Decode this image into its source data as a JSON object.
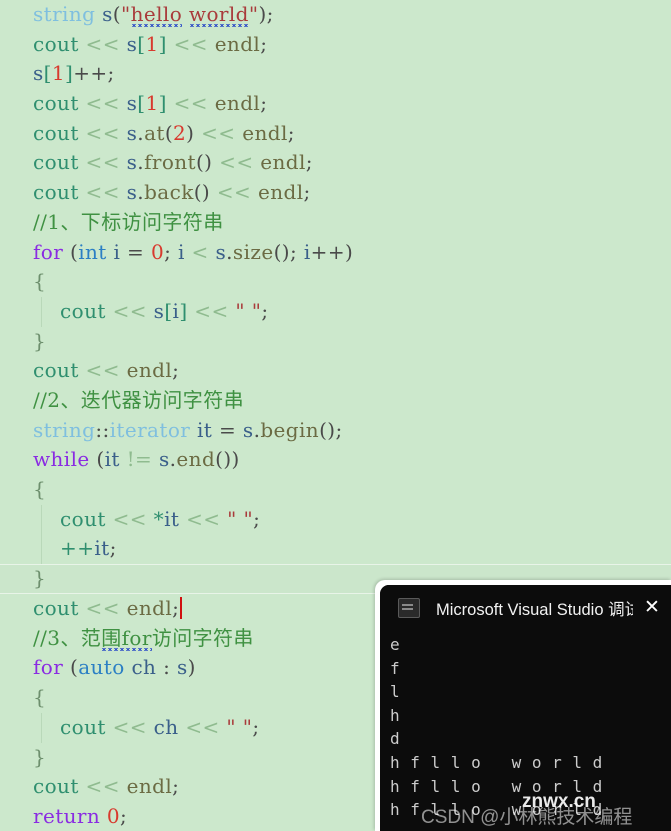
{
  "editor": {
    "background": "#cce8cc",
    "caret_color": "#d01010",
    "current_line_index": 19,
    "lines": [
      {
        "indent": 0,
        "guide": false,
        "tokens": [
          {
            "t": "string",
            "c": "t-type"
          },
          {
            "t": " ",
            "c": "t-plain"
          },
          {
            "t": "s",
            "c": "t-ident"
          },
          {
            "t": "(",
            "c": "t-punct"
          },
          {
            "t": "\"",
            "c": "t-str"
          },
          {
            "t": "hello",
            "c": "t-str",
            "squiggle": true
          },
          {
            "t": " ",
            "c": "t-str"
          },
          {
            "t": "world",
            "c": "t-str",
            "squiggle": true
          },
          {
            "t": "\"",
            "c": "t-str"
          },
          {
            "t": ")",
            "c": "t-punct"
          },
          {
            "t": ";",
            "c": "t-punct"
          }
        ]
      },
      {
        "indent": 0,
        "guide": false,
        "tokens": [
          {
            "t": "cout",
            "c": "t-stream"
          },
          {
            "t": " ",
            "c": "t-plain"
          },
          {
            "t": "<<",
            "c": "t-op"
          },
          {
            "t": " ",
            "c": "t-plain"
          },
          {
            "t": "s",
            "c": "t-ident"
          },
          {
            "t": "[",
            "c": "t-stream"
          },
          {
            "t": "1",
            "c": "t-num"
          },
          {
            "t": "]",
            "c": "t-stream"
          },
          {
            "t": " ",
            "c": "t-plain"
          },
          {
            "t": "<<",
            "c": "t-op"
          },
          {
            "t": " ",
            "c": "t-plain"
          },
          {
            "t": "endl",
            "c": "t-member"
          },
          {
            "t": ";",
            "c": "t-punct"
          }
        ]
      },
      {
        "indent": 0,
        "guide": false,
        "tokens": [
          {
            "t": "s",
            "c": "t-ident"
          },
          {
            "t": "[",
            "c": "t-stream"
          },
          {
            "t": "1",
            "c": "t-num"
          },
          {
            "t": "]",
            "c": "t-stream"
          },
          {
            "t": "++;",
            "c": "t-punct"
          }
        ]
      },
      {
        "indent": 0,
        "guide": false,
        "tokens": [
          {
            "t": "cout",
            "c": "t-stream"
          },
          {
            "t": " ",
            "c": "t-plain"
          },
          {
            "t": "<<",
            "c": "t-op"
          },
          {
            "t": " ",
            "c": "t-plain"
          },
          {
            "t": "s",
            "c": "t-ident"
          },
          {
            "t": "[",
            "c": "t-stream"
          },
          {
            "t": "1",
            "c": "t-num"
          },
          {
            "t": "]",
            "c": "t-stream"
          },
          {
            "t": " ",
            "c": "t-plain"
          },
          {
            "t": "<<",
            "c": "t-op"
          },
          {
            "t": " ",
            "c": "t-plain"
          },
          {
            "t": "endl",
            "c": "t-member"
          },
          {
            "t": ";",
            "c": "t-punct"
          }
        ]
      },
      {
        "indent": 0,
        "guide": false,
        "tokens": [
          {
            "t": "cout",
            "c": "t-stream"
          },
          {
            "t": " ",
            "c": "t-plain"
          },
          {
            "t": "<<",
            "c": "t-op"
          },
          {
            "t": " ",
            "c": "t-plain"
          },
          {
            "t": "s",
            "c": "t-ident"
          },
          {
            "t": ".",
            "c": "t-punct"
          },
          {
            "t": "at",
            "c": "t-member"
          },
          {
            "t": "(",
            "c": "t-punct"
          },
          {
            "t": "2",
            "c": "t-num"
          },
          {
            "t": ")",
            "c": "t-punct"
          },
          {
            "t": " ",
            "c": "t-plain"
          },
          {
            "t": "<<",
            "c": "t-op"
          },
          {
            "t": " ",
            "c": "t-plain"
          },
          {
            "t": "endl",
            "c": "t-member"
          },
          {
            "t": ";",
            "c": "t-punct"
          }
        ]
      },
      {
        "indent": 0,
        "guide": false,
        "tokens": [
          {
            "t": "cout",
            "c": "t-stream"
          },
          {
            "t": " ",
            "c": "t-plain"
          },
          {
            "t": "<<",
            "c": "t-op"
          },
          {
            "t": " ",
            "c": "t-plain"
          },
          {
            "t": "s",
            "c": "t-ident"
          },
          {
            "t": ".",
            "c": "t-punct"
          },
          {
            "t": "front",
            "c": "t-member"
          },
          {
            "t": "()",
            "c": "t-punct"
          },
          {
            "t": " ",
            "c": "t-plain"
          },
          {
            "t": "<<",
            "c": "t-op"
          },
          {
            "t": " ",
            "c": "t-plain"
          },
          {
            "t": "endl",
            "c": "t-member"
          },
          {
            "t": ";",
            "c": "t-punct"
          }
        ]
      },
      {
        "indent": 0,
        "guide": false,
        "tokens": [
          {
            "t": "cout",
            "c": "t-stream"
          },
          {
            "t": " ",
            "c": "t-plain"
          },
          {
            "t": "<<",
            "c": "t-op"
          },
          {
            "t": " ",
            "c": "t-plain"
          },
          {
            "t": "s",
            "c": "t-ident"
          },
          {
            "t": ".",
            "c": "t-punct"
          },
          {
            "t": "back",
            "c": "t-member"
          },
          {
            "t": "()",
            "c": "t-punct"
          },
          {
            "t": " ",
            "c": "t-plain"
          },
          {
            "t": "<<",
            "c": "t-op"
          },
          {
            "t": " ",
            "c": "t-plain"
          },
          {
            "t": "endl",
            "c": "t-member"
          },
          {
            "t": ";",
            "c": "t-punct"
          }
        ]
      },
      {
        "indent": 0,
        "guide": false,
        "tokens": [
          {
            "t": "//1、下标访问字符串",
            "c": "t-cmt"
          }
        ]
      },
      {
        "indent": 0,
        "guide": false,
        "tokens": [
          {
            "t": "for",
            "c": "t-kw"
          },
          {
            "t": " ",
            "c": "t-plain"
          },
          {
            "t": "(",
            "c": "t-punct"
          },
          {
            "t": "int",
            "c": "t-type2"
          },
          {
            "t": " ",
            "c": "t-plain"
          },
          {
            "t": "i",
            "c": "t-ident"
          },
          {
            "t": " = ",
            "c": "t-punct"
          },
          {
            "t": "0",
            "c": "t-num"
          },
          {
            "t": "; ",
            "c": "t-punct"
          },
          {
            "t": "i",
            "c": "t-ident"
          },
          {
            "t": " ",
            "c": "t-plain"
          },
          {
            "t": "<",
            "c": "t-op"
          },
          {
            "t": " ",
            "c": "t-plain"
          },
          {
            "t": "s",
            "c": "t-ident"
          },
          {
            "t": ".",
            "c": "t-punct"
          },
          {
            "t": "size",
            "c": "t-member"
          },
          {
            "t": "()",
            "c": "t-punct"
          },
          {
            "t": "; ",
            "c": "t-punct"
          },
          {
            "t": "i",
            "c": "t-ident"
          },
          {
            "t": "++)",
            "c": "t-punct"
          }
        ]
      },
      {
        "indent": 0,
        "guide": false,
        "tokens": [
          {
            "t": "{",
            "c": "t-brace"
          }
        ]
      },
      {
        "indent": 1,
        "guide": true,
        "tokens": [
          {
            "t": "    ",
            "c": "t-plain"
          },
          {
            "t": "cout",
            "c": "t-stream"
          },
          {
            "t": " ",
            "c": "t-plain"
          },
          {
            "t": "<<",
            "c": "t-op"
          },
          {
            "t": " ",
            "c": "t-plain"
          },
          {
            "t": "s",
            "c": "t-ident"
          },
          {
            "t": "[",
            "c": "t-stream"
          },
          {
            "t": "i",
            "c": "t-ident"
          },
          {
            "t": "]",
            "c": "t-stream"
          },
          {
            "t": " ",
            "c": "t-plain"
          },
          {
            "t": "<<",
            "c": "t-op"
          },
          {
            "t": " ",
            "c": "t-plain"
          },
          {
            "t": "\" \"",
            "c": "t-str"
          },
          {
            "t": ";",
            "c": "t-punct"
          }
        ]
      },
      {
        "indent": 0,
        "guide": false,
        "tokens": [
          {
            "t": "}",
            "c": "t-brace"
          }
        ]
      },
      {
        "indent": 0,
        "guide": false,
        "tokens": [
          {
            "t": "cout",
            "c": "t-stream"
          },
          {
            "t": " ",
            "c": "t-plain"
          },
          {
            "t": "<<",
            "c": "t-op"
          },
          {
            "t": " ",
            "c": "t-plain"
          },
          {
            "t": "endl",
            "c": "t-member"
          },
          {
            "t": ";",
            "c": "t-punct"
          }
        ]
      },
      {
        "indent": 0,
        "guide": false,
        "tokens": [
          {
            "t": "//2、迭代器访问字符串",
            "c": "t-cmt"
          }
        ]
      },
      {
        "indent": 0,
        "guide": false,
        "tokens": [
          {
            "t": "string",
            "c": "t-type"
          },
          {
            "t": "::",
            "c": "t-punct"
          },
          {
            "t": "iterator",
            "c": "t-type"
          },
          {
            "t": " ",
            "c": "t-plain"
          },
          {
            "t": "it",
            "c": "t-ident"
          },
          {
            "t": " = ",
            "c": "t-punct"
          },
          {
            "t": "s",
            "c": "t-ident"
          },
          {
            "t": ".",
            "c": "t-punct"
          },
          {
            "t": "begin",
            "c": "t-member"
          },
          {
            "t": "()",
            "c": "t-punct"
          },
          {
            "t": ";",
            "c": "t-punct"
          }
        ]
      },
      {
        "indent": 0,
        "guide": false,
        "tokens": [
          {
            "t": "while",
            "c": "t-kw"
          },
          {
            "t": " ",
            "c": "t-plain"
          },
          {
            "t": "(",
            "c": "t-punct"
          },
          {
            "t": "it",
            "c": "t-ident"
          },
          {
            "t": " ",
            "c": "t-plain"
          },
          {
            "t": "!=",
            "c": "t-op"
          },
          {
            "t": " ",
            "c": "t-plain"
          },
          {
            "t": "s",
            "c": "t-ident"
          },
          {
            "t": ".",
            "c": "t-punct"
          },
          {
            "t": "end",
            "c": "t-member"
          },
          {
            "t": "())",
            "c": "t-punct"
          }
        ]
      },
      {
        "indent": 0,
        "guide": false,
        "tokens": [
          {
            "t": "{",
            "c": "t-brace"
          }
        ]
      },
      {
        "indent": 1,
        "guide": true,
        "tokens": [
          {
            "t": "    ",
            "c": "t-plain"
          },
          {
            "t": "cout",
            "c": "t-stream"
          },
          {
            "t": " ",
            "c": "t-plain"
          },
          {
            "t": "<<",
            "c": "t-op"
          },
          {
            "t": " ",
            "c": "t-plain"
          },
          {
            "t": "*",
            "c": "t-stream"
          },
          {
            "t": "it",
            "c": "t-ident"
          },
          {
            "t": " ",
            "c": "t-plain"
          },
          {
            "t": "<<",
            "c": "t-op"
          },
          {
            "t": " ",
            "c": "t-plain"
          },
          {
            "t": "\" \"",
            "c": "t-str"
          },
          {
            "t": ";",
            "c": "t-punct"
          }
        ]
      },
      {
        "indent": 1,
        "guide": true,
        "tokens": [
          {
            "t": "    ",
            "c": "t-plain"
          },
          {
            "t": "++",
            "c": "t-stream"
          },
          {
            "t": "it",
            "c": "t-ident"
          },
          {
            "t": ";",
            "c": "t-punct"
          }
        ]
      },
      {
        "indent": 0,
        "guide": false,
        "tokens": [
          {
            "t": "}",
            "c": "t-brace"
          }
        ]
      },
      {
        "indent": 0,
        "guide": false,
        "caret": true,
        "tokens": [
          {
            "t": "cout",
            "c": "t-stream"
          },
          {
            "t": " ",
            "c": "t-plain"
          },
          {
            "t": "<<",
            "c": "t-op"
          },
          {
            "t": " ",
            "c": "t-plain"
          },
          {
            "t": "endl",
            "c": "t-member"
          },
          {
            "t": ";",
            "c": "t-punct"
          }
        ]
      },
      {
        "indent": 0,
        "guide": false,
        "tokens": [
          {
            "t": "//3、范",
            "c": "t-cmt"
          },
          {
            "t": "围for",
            "c": "t-cmt",
            "squiggle": true
          },
          {
            "t": "访问字符串",
            "c": "t-cmt"
          }
        ]
      },
      {
        "indent": 0,
        "guide": false,
        "tokens": [
          {
            "t": "for",
            "c": "t-kw"
          },
          {
            "t": " ",
            "c": "t-plain"
          },
          {
            "t": "(",
            "c": "t-punct"
          },
          {
            "t": "auto",
            "c": "t-type2"
          },
          {
            "t": " ",
            "c": "t-plain"
          },
          {
            "t": "ch",
            "c": "t-ident"
          },
          {
            "t": " : ",
            "c": "t-punct"
          },
          {
            "t": "s",
            "c": "t-ident"
          },
          {
            "t": ")",
            "c": "t-punct"
          }
        ]
      },
      {
        "indent": 0,
        "guide": false,
        "tokens": [
          {
            "t": "{",
            "c": "t-brace"
          }
        ]
      },
      {
        "indent": 1,
        "guide": true,
        "tokens": [
          {
            "t": "    ",
            "c": "t-plain"
          },
          {
            "t": "cout",
            "c": "t-stream"
          },
          {
            "t": " ",
            "c": "t-plain"
          },
          {
            "t": "<<",
            "c": "t-op"
          },
          {
            "t": " ",
            "c": "t-plain"
          },
          {
            "t": "ch",
            "c": "t-ident"
          },
          {
            "t": " ",
            "c": "t-plain"
          },
          {
            "t": "<<",
            "c": "t-op"
          },
          {
            "t": " ",
            "c": "t-plain"
          },
          {
            "t": "\" \"",
            "c": "t-str"
          },
          {
            "t": ";",
            "c": "t-punct"
          }
        ]
      },
      {
        "indent": 0,
        "guide": false,
        "tokens": [
          {
            "t": "}",
            "c": "t-brace"
          }
        ]
      },
      {
        "indent": 0,
        "guide": false,
        "tokens": [
          {
            "t": "cout",
            "c": "t-stream"
          },
          {
            "t": " ",
            "c": "t-plain"
          },
          {
            "t": "<<",
            "c": "t-op"
          },
          {
            "t": " ",
            "c": "t-plain"
          },
          {
            "t": "endl",
            "c": "t-member"
          },
          {
            "t": ";",
            "c": "t-punct"
          }
        ]
      },
      {
        "indent": 0,
        "guide": false,
        "tokens": [
          {
            "t": "return",
            "c": "t-kw"
          },
          {
            "t": " ",
            "c": "t-plain"
          },
          {
            "t": "0",
            "c": "t-num"
          },
          {
            "t": ";",
            "c": "t-punct"
          }
        ]
      }
    ]
  },
  "console": {
    "title": "Microsoft Visual Studio 调试控",
    "close_label": "✕",
    "icon": "console-app-icon",
    "background": "#0c0c0c",
    "output_lines": [
      "e",
      "f",
      "l",
      "h",
      "d",
      "h f l l o   w o r l d",
      "h f l l o   w o r l d",
      "h f l l o   w o r l d"
    ],
    "watermark_csdn": "CSDN @小林熊技术编程",
    "watermark_site": "znwx.cn"
  }
}
